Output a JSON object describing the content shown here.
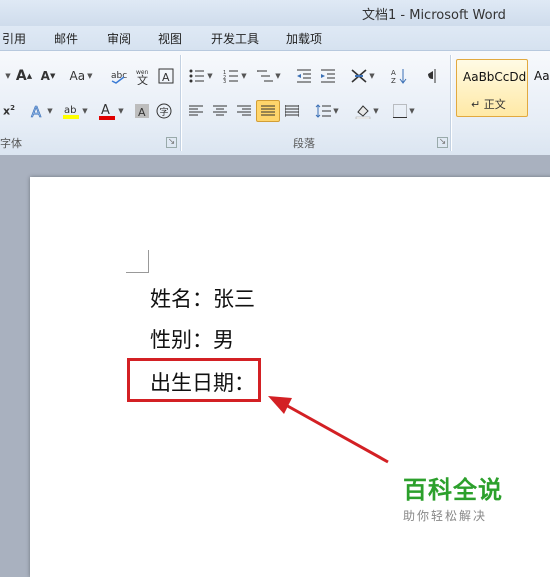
{
  "window": {
    "title": "文档1 - Microsoft Word"
  },
  "tabs": [
    "引用",
    "邮件",
    "审阅",
    "视图",
    "开发工具",
    "加载项"
  ],
  "ribbon": {
    "font_group_label": "字体",
    "paragraph_group_label": "段落",
    "styles": [
      {
        "sample": "AaBbCcDd",
        "name": "↵ 正文"
      },
      {
        "sample": "Aa"
      }
    ]
  },
  "document": {
    "lines": [
      "姓名：张三",
      "性别：男",
      "出生日期："
    ]
  },
  "watermark": {
    "title": "百科全说",
    "subtitle": "助你轻松解决"
  },
  "colors": {
    "highlight": "#d32024",
    "brand_green": "#2ca02c"
  }
}
